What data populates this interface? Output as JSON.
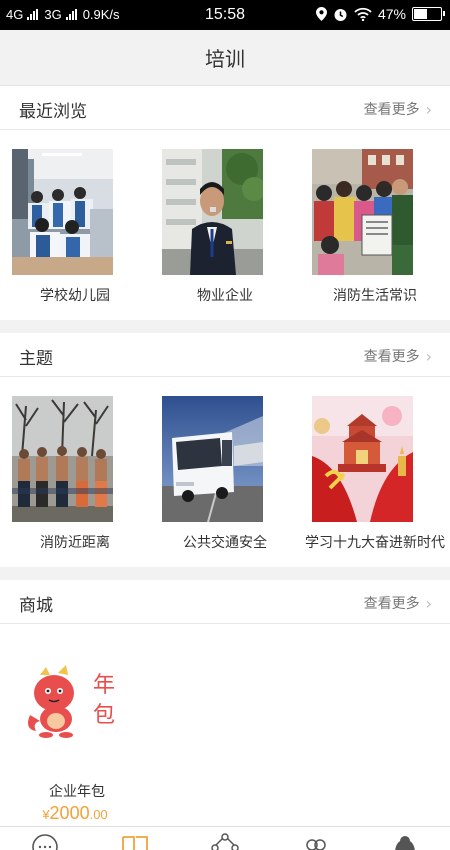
{
  "status_bar": {
    "network1": "4G",
    "network2": "3G",
    "speed": "0.9K/s",
    "time": "15:58",
    "battery": "47%",
    "battery_level": 0.47
  },
  "header": {
    "title": "培训"
  },
  "recent": {
    "title": "最近浏览",
    "more": "查看更多",
    "items": [
      {
        "label": "学校幼儿园"
      },
      {
        "label": "物业企业"
      },
      {
        "label": "消防生活常识"
      }
    ]
  },
  "topics": {
    "title": "主题",
    "more": "查看更多",
    "items": [
      {
        "label": "消防近距离"
      },
      {
        "label": "公共交通安全"
      },
      {
        "label": "学习十九大奋进新时代"
      }
    ]
  },
  "mall": {
    "title": "商城",
    "more": "查看更多",
    "product": {
      "badge_char1": "年",
      "badge_char2": "包",
      "name": "企业年包",
      "currency": "¥",
      "price_int": "2000",
      "price_dec": ".00"
    }
  },
  "tabbar": {
    "icons": [
      "chat-icon",
      "book-icon",
      "network-icon",
      "users-icon",
      "profile-icon"
    ],
    "active": 1,
    "active_color": "#f3a23a"
  },
  "colors": {
    "accent": "#f3a23a",
    "background": "#f2f2f2"
  }
}
